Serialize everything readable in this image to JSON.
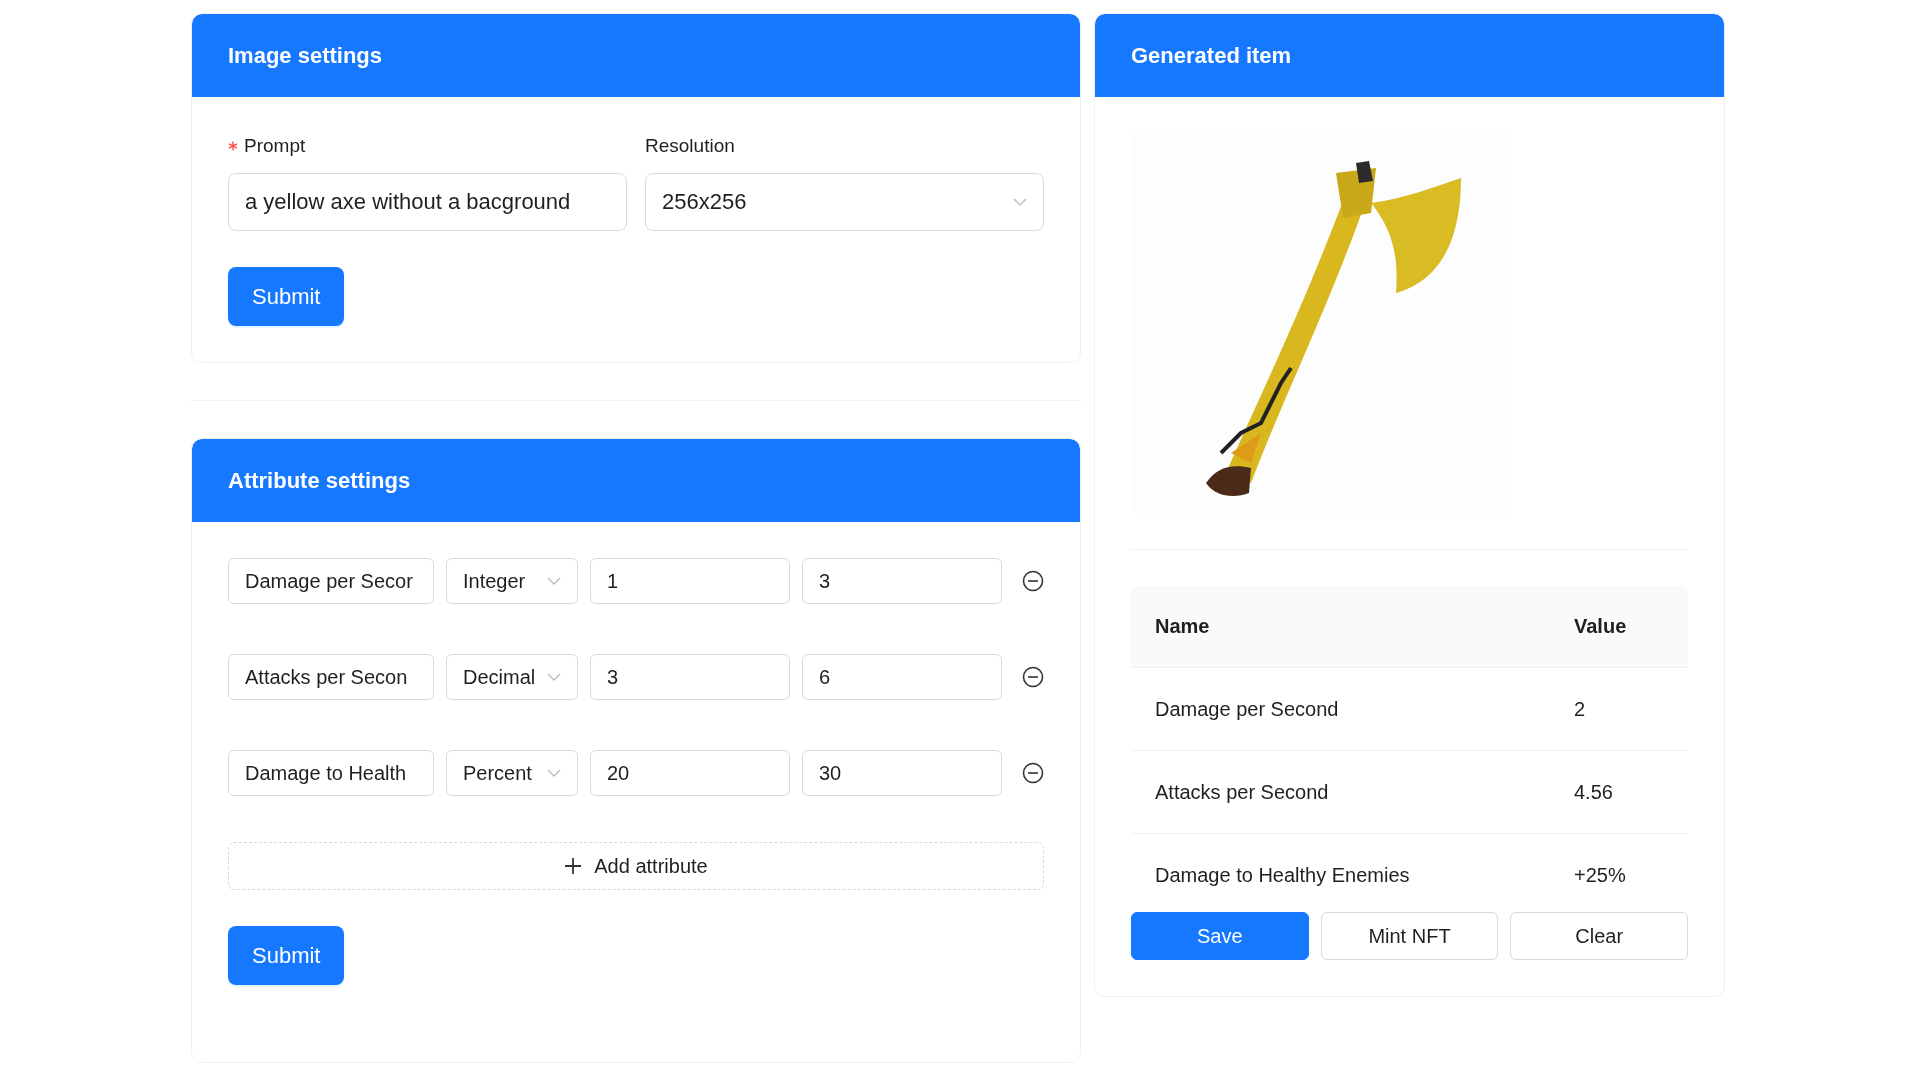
{
  "image_settings": {
    "title": "Image settings",
    "prompt": {
      "label": "Prompt",
      "required": true,
      "value": "a yellow axe without a bacground"
    },
    "resolution": {
      "label": "Resolution",
      "value": "256x256"
    },
    "submit": "Submit"
  },
  "attribute_settings": {
    "title": "Attribute settings",
    "attributes": [
      {
        "name": "Damage per Secor",
        "type": "Integer",
        "min": "1",
        "max": "3"
      },
      {
        "name": "Attacks per Secon",
        "type": "Decimal",
        "min": "3",
        "max": "6"
      },
      {
        "name": "Damage to Health",
        "type": "Percent",
        "min": "20",
        "max": "30"
      }
    ],
    "add": "Add attribute",
    "submit": "Submit"
  },
  "generated_item": {
    "title": "Generated item",
    "table": {
      "columns": [
        "Name",
        "Value"
      ],
      "rows": [
        [
          "Damage per Second",
          "2"
        ],
        [
          "Attacks per Second",
          "4.56"
        ],
        [
          "Damage to Healthy Enemies",
          "+25%"
        ]
      ]
    },
    "buttons": [
      {
        "label": "Save",
        "primary": true
      },
      {
        "label": "Mint NFT",
        "primary": false
      },
      {
        "label": "Clear",
        "primary": false
      }
    ]
  }
}
